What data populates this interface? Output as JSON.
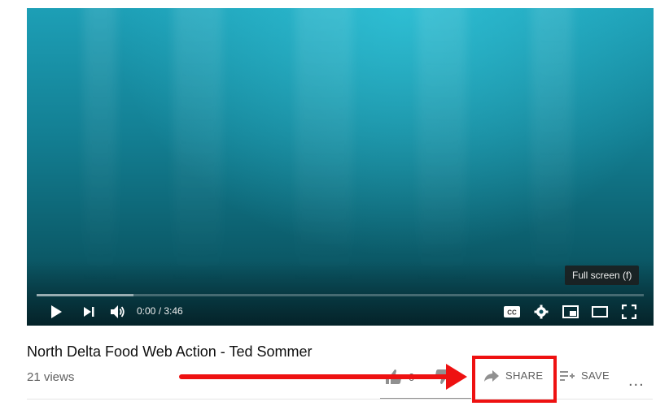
{
  "video": {
    "title": "North Delta Food Web Action - Ted Sommer",
    "views": "21 views",
    "time_display": "0:00 / 3:46",
    "fullscreen_tooltip": "Full screen (f)",
    "loaded_fraction": 0.16,
    "icons": [
      "play-icon",
      "next-icon",
      "volume-icon",
      "captions-icon",
      "settings-icon",
      "miniplayer-icon",
      "theater-icon",
      "fullscreen-icon"
    ]
  },
  "actions": {
    "like_count": "0",
    "share_label": "SHARE",
    "save_label": "SAVE",
    "more_label": "..."
  },
  "annotation": {
    "color": "#ee1111"
  }
}
